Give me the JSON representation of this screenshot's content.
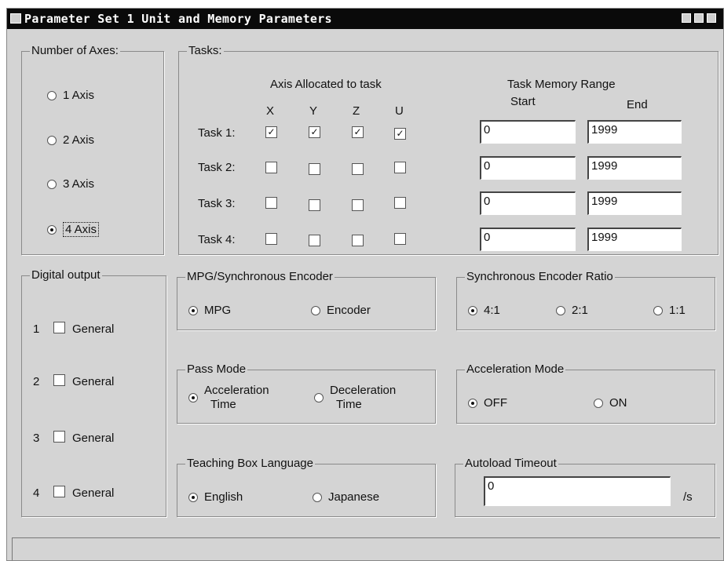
{
  "window": {
    "title": "Parameter Set 1 Unit and Memory Parameters"
  },
  "axes_group": {
    "legend": "Number of Axes:",
    "options": [
      "1 Axis",
      "2 Axis",
      "3 Axis",
      "4 Axis"
    ],
    "selected": "4 Axis"
  },
  "tasks_group": {
    "legend": "Tasks:",
    "axis_allocated_label": "Axis Allocated to task",
    "axis_headers": [
      "X",
      "Y",
      "Z",
      "U"
    ],
    "memory_range_label": "Task Memory Range",
    "start_label": "Start",
    "end_label": "End",
    "rows": [
      {
        "label": "Task 1:",
        "start": "0",
        "end": "1999",
        "x": true,
        "y": true,
        "z": true,
        "u": true
      },
      {
        "label": "Task 2:",
        "start": "0",
        "end": "1999",
        "x": false,
        "y": false,
        "z": false,
        "u": false
      },
      {
        "label": "Task 3:",
        "start": "0",
        "end": "1999",
        "x": false,
        "y": false,
        "z": false,
        "u": false
      },
      {
        "label": "Task 4:",
        "start": "0",
        "end": "1999",
        "x": false,
        "y": false,
        "z": false,
        "u": false
      }
    ]
  },
  "digital_output": {
    "legend": "Digital output",
    "items": [
      {
        "num": "1",
        "label": "General",
        "checked": false
      },
      {
        "num": "2",
        "label": "General",
        "checked": false
      },
      {
        "num": "3",
        "label": "General",
        "checked": false
      },
      {
        "num": "4",
        "label": "General",
        "checked": false
      }
    ]
  },
  "mpg_group": {
    "legend": "MPG/Synchronous Encoder",
    "options": [
      "MPG",
      "Encoder"
    ],
    "selected": "MPG"
  },
  "ratio_group": {
    "legend": "Synchronous Encoder Ratio",
    "options": [
      "4:1",
      "2:1",
      "1:1"
    ],
    "selected": "4:1"
  },
  "pass_group": {
    "legend": "Pass Mode",
    "opt1_line1": "Acceleration",
    "opt1_line2": "Time",
    "opt2_line1": "Deceleration",
    "opt2_line2": "Time",
    "selected": "Acceleration Time"
  },
  "accel_group": {
    "legend": "Acceleration Mode",
    "options": [
      "OFF",
      "ON"
    ],
    "selected": "OFF"
  },
  "teach_group": {
    "legend": "Teaching Box Language",
    "options": [
      "English",
      "Japanese"
    ],
    "selected": "English"
  },
  "autoload_group": {
    "legend": "Autoload Timeout",
    "value": "0",
    "unit": "/s"
  },
  "colors": {
    "titlebar": "#0a0a0a",
    "face": "#d4d4d4",
    "field": "#ffffff"
  }
}
